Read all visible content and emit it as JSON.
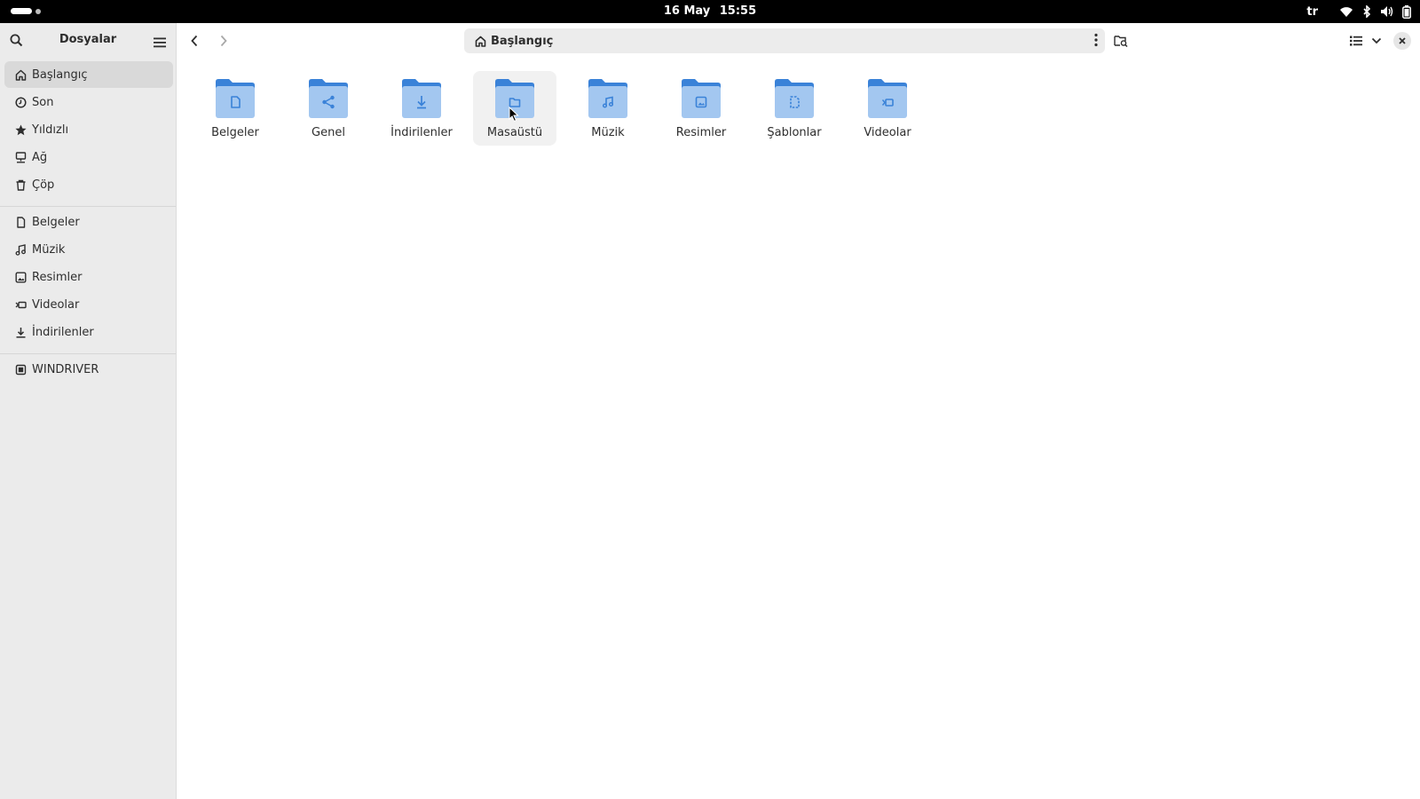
{
  "topbar": {
    "date": "16 May",
    "time": "15:55",
    "language": "tr",
    "icons": [
      "wifi-icon",
      "bluetooth-icon",
      "volume-icon",
      "battery-icon"
    ]
  },
  "sidebar": {
    "title": "Dosyalar",
    "places": [
      {
        "label": "Başlangıç",
        "icon": "home-icon",
        "active": true
      },
      {
        "label": "Son",
        "icon": "clock-icon"
      },
      {
        "label": "Yıldızlı",
        "icon": "star-icon"
      },
      {
        "label": "Ağ",
        "icon": "network-icon"
      },
      {
        "label": "Çöp",
        "icon": "trash-icon"
      }
    ],
    "bookmarks": [
      {
        "label": "Belgeler",
        "icon": "document-icon"
      },
      {
        "label": "Müzik",
        "icon": "music-icon"
      },
      {
        "label": "Resimler",
        "icon": "picture-icon"
      },
      {
        "label": "Videolar",
        "icon": "video-icon"
      },
      {
        "label": "İndirilenler",
        "icon": "download-icon"
      }
    ],
    "devices": [
      {
        "label": "WINDRIVER",
        "icon": "drive-icon"
      }
    ]
  },
  "pathbar": {
    "location": "Başlangıç",
    "icon": "home-icon"
  },
  "folders": [
    {
      "label": "Belgeler",
      "icon": "document-icon"
    },
    {
      "label": "Genel",
      "icon": "share-icon"
    },
    {
      "label": "İndirilenler",
      "icon": "download-icon"
    },
    {
      "label": "Masaüstü",
      "icon": "desktop-icon",
      "hovered": true
    },
    {
      "label": "Müzik",
      "icon": "music-icon"
    },
    {
      "label": "Resimler",
      "icon": "picture-icon"
    },
    {
      "label": "Şablonlar",
      "icon": "template-icon"
    },
    {
      "label": "Videolar",
      "icon": "video-icon"
    }
  ],
  "colors": {
    "folder_back": "#3a82d8",
    "folder_front": "#a3c7f0",
    "folder_glyph": "#3a82d8",
    "sidebar_bg": "#ebebeb",
    "active_item": "#d9d9d9"
  }
}
